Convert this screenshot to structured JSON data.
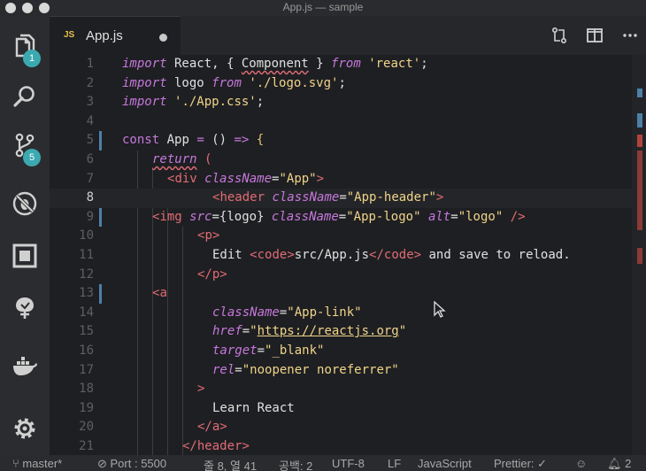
{
  "window": {
    "title": "App.js — sample"
  },
  "activity_bar": {
    "items": [
      {
        "icon": "files-icon",
        "badge": "1"
      },
      {
        "icon": "search-icon"
      },
      {
        "icon": "source-control-icon",
        "badge": "5"
      },
      {
        "icon": "debug-icon"
      },
      {
        "icon": "extensions-icon"
      },
      {
        "icon": "tree-icon"
      },
      {
        "icon": "docker-icon"
      },
      {
        "icon": "gear-icon"
      }
    ]
  },
  "tabs": [
    {
      "label": "App.js",
      "file_type": "JS",
      "dirty": true
    }
  ],
  "editor": {
    "lines": [
      {
        "n": "1"
      },
      {
        "n": "2"
      },
      {
        "n": "3"
      },
      {
        "n": "4"
      },
      {
        "n": "5"
      },
      {
        "n": "6"
      },
      {
        "n": "7"
      },
      {
        "n": "8"
      },
      {
        "n": "9"
      },
      {
        "n": "10"
      },
      {
        "n": "11"
      },
      {
        "n": "12"
      },
      {
        "n": "13"
      },
      {
        "n": "14"
      },
      {
        "n": "15"
      },
      {
        "n": "16"
      },
      {
        "n": "17"
      },
      {
        "n": "18"
      },
      {
        "n": "19"
      },
      {
        "n": "20"
      },
      {
        "n": "21"
      }
    ],
    "tokens": {
      "l1": [
        "import",
        " React, { ",
        "Component",
        " } ",
        "from",
        " ",
        "'react'",
        ";"
      ],
      "l2": [
        "import",
        " logo ",
        "from",
        " ",
        "'./logo.svg'",
        ";"
      ],
      "l3": [
        "import",
        " ",
        "'./App.css'",
        ";"
      ],
      "l5": [
        "const",
        " App ",
        "=",
        " () ",
        "=>",
        " {"
      ],
      "l6": [
        "return",
        " ("
      ],
      "l7": [
        "<",
        "div",
        " ",
        "className",
        "=",
        "\"App\"",
        ">"
      ],
      "l8": [
        "<",
        "header",
        " ",
        "className",
        "=",
        "\"App-header\"",
        ">"
      ],
      "l9": [
        "<",
        "img",
        " ",
        "src",
        "=",
        "{logo}",
        " ",
        "className",
        "=",
        "\"App-logo\"",
        " ",
        "alt",
        "=",
        "\"logo\"",
        " />"
      ],
      "l10": [
        "<",
        "p",
        ">"
      ],
      "l11": [
        "Edit ",
        "<",
        "code",
        ">",
        "src/App.js",
        "</",
        "code",
        ">",
        " and save to reload."
      ],
      "l12": [
        "</",
        "p",
        ">"
      ],
      "l13": [
        "<",
        "a"
      ],
      "l14": [
        "className",
        "=",
        "\"App-link\""
      ],
      "l15": [
        "href",
        "=",
        "\"",
        "https://reactjs.org",
        "\""
      ],
      "l16": [
        "target",
        "=",
        "\"_blank\""
      ],
      "l17": [
        "rel",
        "=",
        "\"noopener noreferrer\""
      ],
      "l18": [
        ">"
      ],
      "l19": [
        "Learn React"
      ],
      "l20": [
        "</",
        "a",
        ">"
      ],
      "l21": [
        "</",
        "header",
        ">"
      ]
    },
    "current_line": "8"
  },
  "status_bar": {
    "branch": "master*",
    "port": "Port : 5500",
    "position": "줄 8, 열 41",
    "spaces": "공백: 2",
    "encoding": "UTF-8",
    "eol": "LF",
    "language": "JavaScript",
    "formatter": "Prettier: ✓",
    "notifications": "2"
  },
  "colors": {
    "keyword": "#c678dd",
    "string": "#f0d48a",
    "tag": "#e06c75",
    "badge": "#3ba9b0",
    "gutter_modified": "#4c80a8"
  }
}
